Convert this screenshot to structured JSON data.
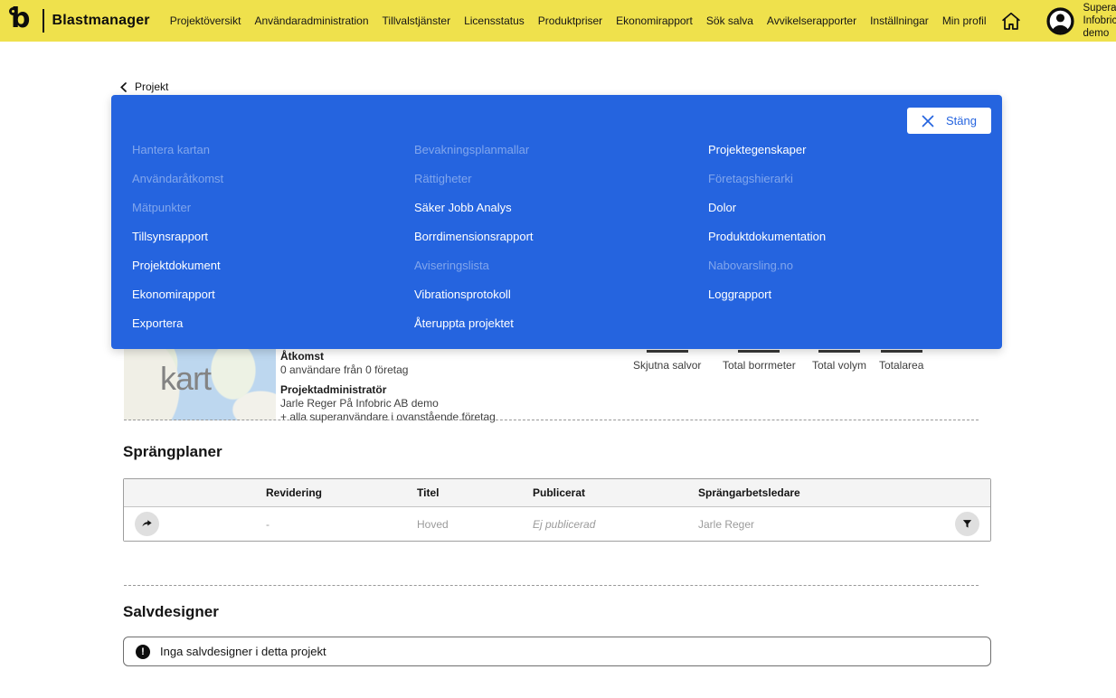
{
  "topbar": {
    "brand": "Blastmanager",
    "nav": [
      "Projektöversikt",
      "Användaradministration",
      "Tillvalstjänster",
      "Licensstatus",
      "Produktpriser",
      "Ekonomirapport",
      "Sök salva",
      "Avvikelserapporter",
      "Inställningar",
      "Min profil"
    ],
    "profile": {
      "role": "Superanvändare",
      "company": "Infobric AB demo"
    }
  },
  "breadcrumb": {
    "label": "Projekt"
  },
  "menu": {
    "close": "Stäng",
    "columns": [
      {
        "items": [
          {
            "label": "Hantera kartan",
            "enabled": false
          },
          {
            "label": "Användaråtkomst",
            "enabled": false
          },
          {
            "label": "Mätpunkter",
            "enabled": false
          },
          {
            "label": "Tillsynsrapport",
            "enabled": true
          },
          {
            "label": "Projektdokument",
            "enabled": true
          },
          {
            "label": "Ekonomirapport",
            "enabled": true
          },
          {
            "label": "Exportera",
            "enabled": true
          }
        ]
      },
      {
        "items": [
          {
            "label": "Bevakningsplanmallar",
            "enabled": false
          },
          {
            "label": "Rättigheter",
            "enabled": false
          },
          {
            "label": "Säker Jobb Analys",
            "enabled": true
          },
          {
            "label": "Borrdimensionsrapport",
            "enabled": true
          },
          {
            "label": "Aviseringslista",
            "enabled": false
          },
          {
            "label": "Vibrationsprotokoll",
            "enabled": true
          },
          {
            "label": "Återuppta projektet",
            "enabled": true
          }
        ]
      },
      {
        "items": [
          {
            "label": "Projektegenskaper",
            "enabled": true
          },
          {
            "label": "Företagshierarki",
            "enabled": false
          },
          {
            "label": "Dolor",
            "enabled": true
          },
          {
            "label": "Produktdokumentation",
            "enabled": true
          },
          {
            "label": "Nabovarsling.no",
            "enabled": false
          },
          {
            "label": "Loggrapport",
            "enabled": true
          }
        ]
      }
    ]
  },
  "summary": {
    "map_placeholder": "kart",
    "access_title": "Åtkomst",
    "access_value": "0 användare från 0 företag",
    "admin_title": "Projektadministratör",
    "admin_name": "Jarle Reger På Infobric AB demo",
    "admin_extra": "+ alla superanvändare i ovanstående företag",
    "stats": [
      {
        "label": "Skjutna salvor"
      },
      {
        "label": "Total borrmeter"
      },
      {
        "label": "Total volym"
      },
      {
        "label": "Totalarea"
      }
    ]
  },
  "sprangplaner": {
    "title": "Sprängplaner",
    "columns": [
      "Revidering",
      "Titel",
      "Publicerat",
      "Sprängarbetsledare"
    ],
    "rows": [
      {
        "revidering": "-",
        "titel": "Hoved",
        "publicerat": "Ej publicerad",
        "sprangarbetsledare": "Jarle Reger"
      }
    ]
  },
  "salvdesigner": {
    "title": "Salvdesigner",
    "empty_message": "Inga salvdesigner i detta projekt"
  },
  "colors": {
    "topbar_yellow": "#EFE14C",
    "panel_blue": "#2564DF",
    "muted_text": "#9B9B9B",
    "stat_bar": "#383838"
  }
}
